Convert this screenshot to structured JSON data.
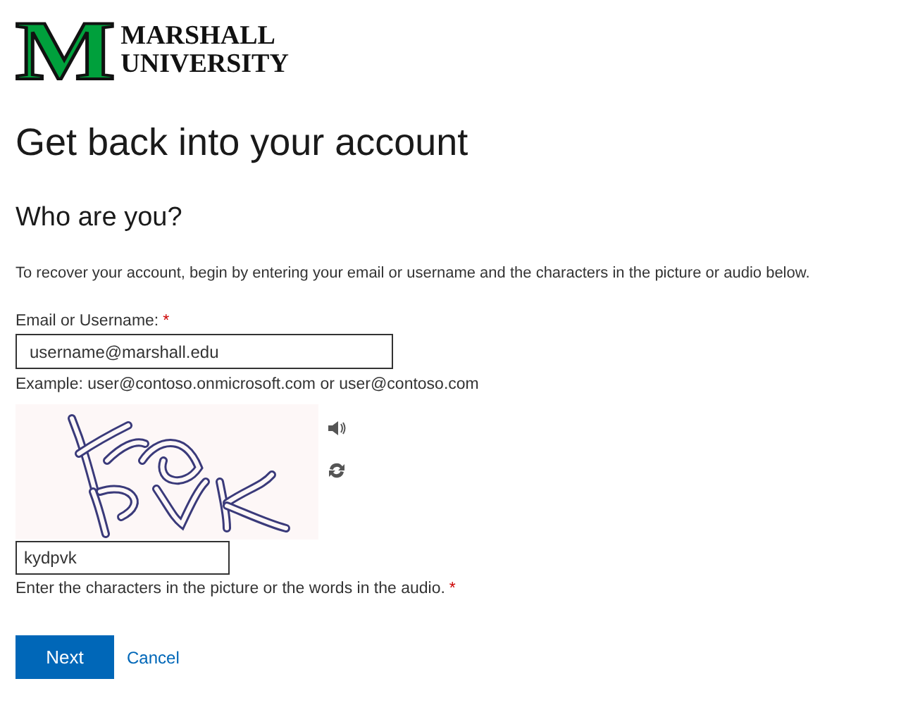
{
  "logo": {
    "mark": "M",
    "lines": [
      "MARSHALL",
      "UNIVERSITY"
    ]
  },
  "title": "Get back into your account",
  "subtitle": "Who are you?",
  "description": "To recover your account, begin by entering your email or username and the characters in the picture or audio below.",
  "email": {
    "label": "Email or Username:",
    "required_mark": "*",
    "value": "username@marshall.edu",
    "hint": "Example: user@contoso.onmicrosoft.com or user@contoso.com"
  },
  "captcha": {
    "value": "kydpvk",
    "hint": "Enter the characters in the picture or the words in the audio.",
    "required_mark": "*"
  },
  "buttons": [
    {
      "label": "Next",
      "kind": "primary"
    },
    {
      "label": "Cancel",
      "kind": "link"
    }
  ]
}
